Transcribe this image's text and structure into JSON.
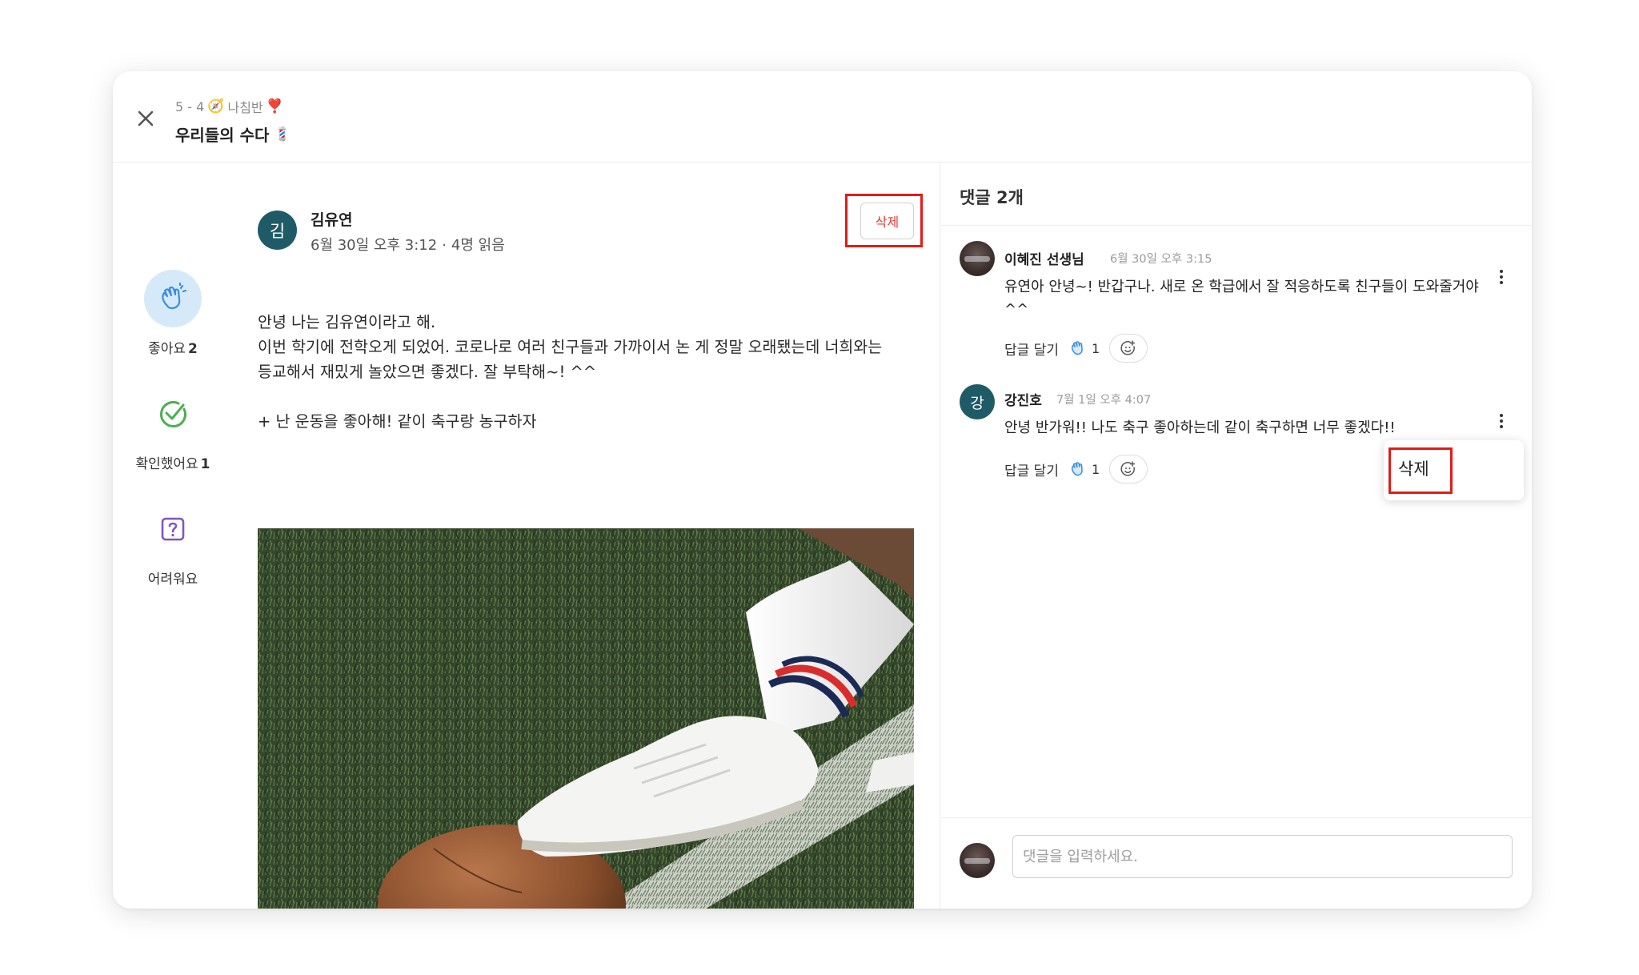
{
  "header": {
    "class_name": "5 - 4",
    "class_emoji_1": "🧭",
    "class_group": "나침반",
    "class_emoji_2": "❣️",
    "board_title": "우리들의 수다",
    "board_emoji": "💈"
  },
  "reactions": [
    {
      "icon": "clapping-hands-icon",
      "label": "좋아요",
      "count": "2"
    },
    {
      "icon": "check-circle-icon",
      "label": "확인했어요",
      "count": "1"
    },
    {
      "icon": "question-box-icon",
      "label": "어려워요",
      "count": ""
    }
  ],
  "post": {
    "avatar_initial": "김",
    "author": "김유연",
    "date": "6월 30일 오후 3:12",
    "separator": "·",
    "reads": "4명 읽음",
    "delete_label": "삭제",
    "body_lines": [
      "안녕 나는 김유연이라고 해.",
      "이번 학기에 전학오게 되었어. 코로나로 여러 친구들과 가까이서 논 게 정말 오래됐는데 너희와는",
      "등교해서 재밌게 놀았으면 좋겠다. 잘 부탁해~! ^^",
      "",
      "+ 난 운동을 좋아해! 같이 축구랑 농구하자"
    ]
  },
  "comments": {
    "count_label": "댓글 2개",
    "items": [
      {
        "author": "이혜진 선생님",
        "time": "6월 30일 오후 3:15",
        "text": "유연아 안녕~! 반갑구나. 새로 온 학급에서 잘 적응하도록 친구들이 도와줄거야 ^^",
        "reply_label": "답글 달기",
        "likes": "1"
      },
      {
        "avatar_initial": "강",
        "author": "강진호",
        "time": "7월 1일 오후 4:07",
        "text": "안녕 반가워!! 나도 축구 좋아하는데 같이 축구하면 너무 좋겠다!!",
        "reply_label": "답글 달기",
        "likes": "1"
      }
    ],
    "menu_delete_label": "삭제",
    "input_placeholder": "댓글을 입력하세요."
  },
  "colors": {
    "accent_red": "#e41b17",
    "avatar_teal": "#1f5b66",
    "like_bubble": "#d5e9f9",
    "check_green": "#4caf50",
    "question_purple": "#7e57c2"
  }
}
